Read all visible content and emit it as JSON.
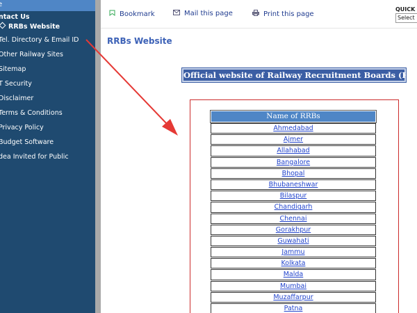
{
  "sidebar": {
    "top_label": "e",
    "items": [
      {
        "label": "ntact Us"
      },
      {
        "label": "RRBs Website"
      },
      {
        "label": "Tel. Directory & Email ID"
      },
      {
        "label": "Other Railway Sites"
      },
      {
        "label": "Sitemap"
      },
      {
        "label": "T Security"
      },
      {
        "label": "Disclaimer"
      },
      {
        "label": "Terms & Conditions"
      },
      {
        "label": "Privacy Policy"
      },
      {
        "label": "Budget Software"
      },
      {
        "label": "dea Invited for Public"
      }
    ]
  },
  "toolbar": {
    "bookmark": "Bookmark",
    "mail": "Mail this page",
    "print": "Print this page",
    "quick_label": "QUICK L",
    "select_value": "Select"
  },
  "main": {
    "title": "RRBs Website",
    "banner": "Official website of Railway Recruitment Boards (RRBs)",
    "table_header": "Name of RRBs",
    "rrbs": [
      "Ahmedabad",
      "Ajmer",
      "Allahabad",
      "Bangalore",
      "Bhopal",
      "Bhubaneshwar",
      "Bilaspur",
      "Chandigarh",
      "Chennai",
      "Gorakhpur",
      "Guwahati",
      "Jammu",
      "Kolkata",
      "Malda",
      "Mumbai",
      "Muzaffarpur",
      "Patna"
    ]
  },
  "colors": {
    "sidebar_bg": "#1f4a70",
    "header_blue": "#4f86c6",
    "banner_blue": "#3b5ea4",
    "annotation_red": "#e53935",
    "link_blue": "#2244cc"
  }
}
